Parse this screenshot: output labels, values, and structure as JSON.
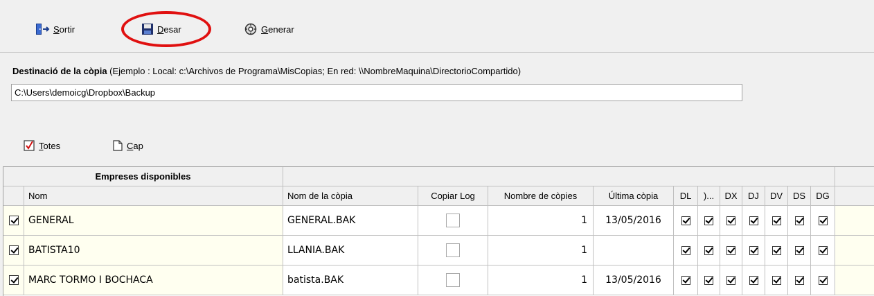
{
  "toolbar": {
    "exit": {
      "mnemonic": "S",
      "rest": "ortir",
      "icon": "exit-door-icon"
    },
    "save": {
      "mnemonic": "D",
      "rest": "esar",
      "icon": "floppy-disk-icon"
    },
    "generate": {
      "mnemonic": "G",
      "rest": "enerar",
      "icon": "generate-gear-icon"
    }
  },
  "destination": {
    "label": "Destinació de la còpia",
    "example": "(Ejemplo : Local: c:\\Archivos de Programa\\MisCopias;  En red: \\\\NombreMaquina\\DirectorioCompartido)",
    "value": "C:\\Users\\demoicg\\Dropbox\\Backup"
  },
  "selection": {
    "all": {
      "mnemonic": "T",
      "rest": "otes",
      "icon": "checked-box-icon"
    },
    "none": {
      "mnemonic": "C",
      "rest": "ap",
      "icon": "blank-page-icon"
    }
  },
  "grid": {
    "group_header": "Empreses disponibles",
    "columns": {
      "nom": "Nom",
      "copy_name": "Nom de la còpia",
      "copy_log": "Copiar Log",
      "num_copies": "Nombre de còpies",
      "last_copy": "Última còpia",
      "dl": "DL",
      "dm": ")...",
      "dx": "DX",
      "dj": "DJ",
      "dv": "DV",
      "ds": "DS",
      "dg": "DG"
    },
    "rows": [
      {
        "selected": true,
        "nom": "GENERAL",
        "copy_name": "GENERAL.BAK",
        "copy_log": false,
        "num_copies": "1",
        "last_copy": "13/05/2016",
        "days": [
          true,
          true,
          true,
          true,
          true,
          true,
          true
        ]
      },
      {
        "selected": true,
        "nom": "BATISTA10",
        "copy_name": "LLANIA.BAK",
        "copy_log": false,
        "num_copies": "1",
        "last_copy": "",
        "days": [
          true,
          true,
          true,
          true,
          true,
          true,
          true
        ]
      },
      {
        "selected": true,
        "nom": "MARC TORMO I BOCHACA",
        "copy_name": "batista.BAK",
        "copy_log": false,
        "num_copies": "1",
        "last_copy": "13/05/2016",
        "days": [
          true,
          true,
          true,
          true,
          true,
          true,
          true
        ]
      }
    ]
  },
  "colors": {
    "highlight": "#e01010",
    "row_yellow": "#fffff0"
  }
}
